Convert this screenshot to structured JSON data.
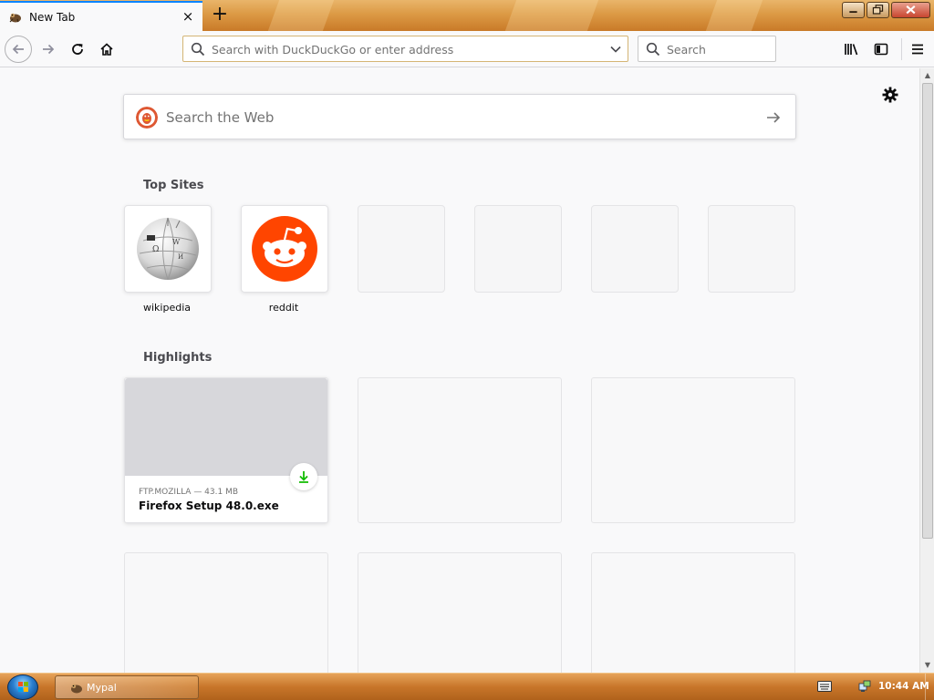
{
  "browser": {
    "tab": {
      "title": "New Tab",
      "close_glyph": "×"
    },
    "new_tab_glyph": "+",
    "urlbar": {
      "placeholder": "Search with DuckDuckGo or enter address"
    },
    "searchbar": {
      "placeholder": "Search"
    }
  },
  "newtab": {
    "web_search": {
      "placeholder": "Search the Web"
    },
    "top_sites": {
      "title": "Top Sites",
      "sites": [
        {
          "label": "wikipedia",
          "icon": "wikipedia-globe-icon"
        },
        {
          "label": "reddit",
          "icon": "reddit-alien-icon"
        },
        {
          "label": ""
        },
        {
          "label": ""
        },
        {
          "label": ""
        },
        {
          "label": ""
        }
      ]
    },
    "highlights": {
      "title": "Highlights",
      "cards": [
        {
          "meta": "FTP.MOZILLA — 43.1 MB",
          "title": "Firefox Setup 48.0.exe",
          "icon": "download-icon"
        }
      ]
    }
  },
  "taskbar": {
    "task": {
      "label": "Mypal"
    },
    "clock": "10:44 AM"
  },
  "colors": {
    "accent": "#0a84ff",
    "reddit": "#ff4500",
    "download_green": "#12bc00",
    "duckduckgo": "#de5833"
  }
}
